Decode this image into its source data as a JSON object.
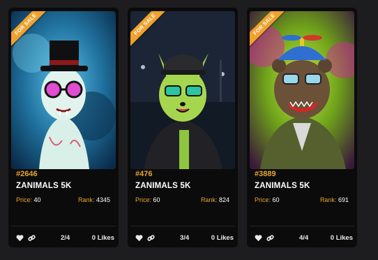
{
  "cards": [
    {
      "badge": "FOR SALE",
      "id": "#2646",
      "collection": "ZANIMALS 5K",
      "price_label": "Price:",
      "price": "40",
      "rank_label": "Rank:",
      "rank": "4345",
      "pages": "2/4",
      "likes": "0 Likes",
      "colors": {
        "bg": "#2a8fc2",
        "glow": "#0d3a5e"
      }
    },
    {
      "badge": "FOR SALE",
      "id": "#476",
      "collection": "ZANIMALS 5K",
      "price_label": "Price:",
      "price": "60",
      "rank_label": "Rank:",
      "rank": "824",
      "pages": "3/4",
      "likes": "0 Likes",
      "colors": {
        "bg": "#1e2a3e",
        "glow": "#0c1220"
      }
    },
    {
      "badge": "FOR SALE",
      "id": "#3889",
      "collection": "ZANIMALS 5K",
      "price_label": "Price:",
      "price": "60",
      "rank_label": "Rank:",
      "rank": "691",
      "pages": "4/4",
      "likes": "0 Likes",
      "colors": {
        "bg": "#7fb01e",
        "glow": "#c42b8e"
      }
    }
  ],
  "icons": {
    "like": "heart-icon",
    "share": "link-icon"
  },
  "accent": "#e8a530"
}
